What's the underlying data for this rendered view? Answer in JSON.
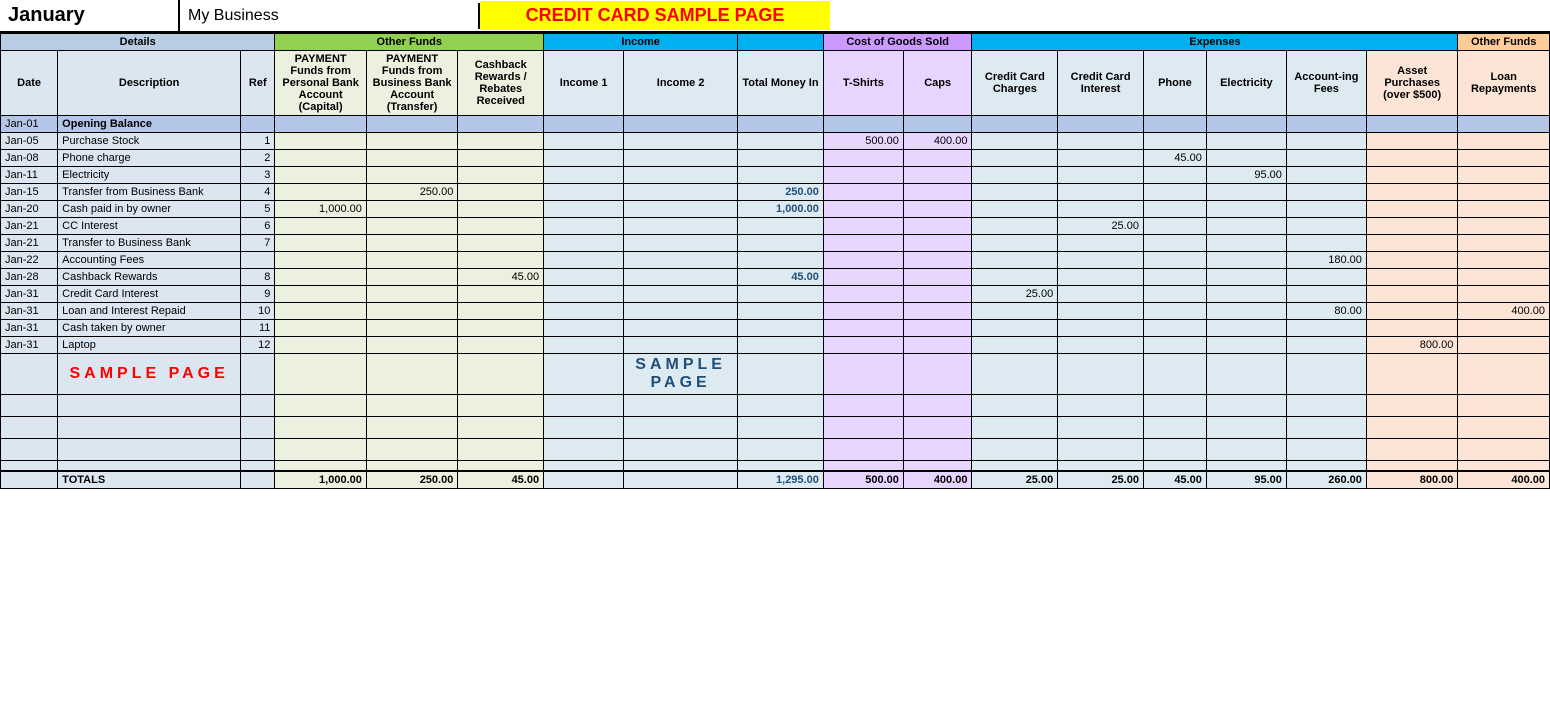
{
  "header": {
    "month": "January",
    "business": "My Business",
    "title": "CREDIT CARD SAMPLE PAGE"
  },
  "sections": {
    "details": "Details",
    "other_funds": "Other Funds",
    "income": "Income",
    "cogs": "Cost of Goods Sold",
    "expenses": "Expenses",
    "other_funds2": "Other Funds"
  },
  "columns": {
    "date": "Date",
    "description": "Description",
    "ref": "Ref",
    "payment_personal": "PAYMENT Funds from Personal Bank Account (Capital)",
    "payment_business": "PAYMENT Funds from Business Bank Account (Transfer)",
    "cashback": "Cashback Rewards / Rebates Received",
    "income1": "Income 1",
    "income2": "Income 2",
    "total_money_in": "Total Money In",
    "tshirts": "T-Shirts",
    "caps": "Caps",
    "cc_charges": "Credit Card Charges",
    "cc_interest": "Credit Card Interest",
    "phone": "Phone",
    "electricity": "Electricity",
    "accounting_fees": "Account-ing Fees",
    "asset_purchases": "Asset Purchases (over $500)",
    "loan_repayments": "Loan Repayments"
  },
  "rows": [
    {
      "date": "Jan-01",
      "desc": "Opening Balance",
      "ref": "",
      "pay_personal": "",
      "pay_business": "",
      "cashback": "",
      "inc1": "",
      "inc2": "",
      "total": "",
      "tshirts": "",
      "caps": "",
      "cc_charges": "",
      "cc_interest": "",
      "phone": "",
      "electricity": "",
      "acct_fees": "",
      "asset_purch": "",
      "loan_rep": "",
      "opening": true
    },
    {
      "date": "Jan-05",
      "desc": "Purchase Stock",
      "ref": "1",
      "pay_personal": "",
      "pay_business": "",
      "cashback": "",
      "inc1": "",
      "inc2": "",
      "total": "",
      "tshirts": "500.00",
      "caps": "400.00",
      "cc_charges": "",
      "cc_interest": "",
      "phone": "",
      "electricity": "",
      "acct_fees": "",
      "asset_purch": "",
      "loan_rep": ""
    },
    {
      "date": "Jan-08",
      "desc": "Phone charge",
      "ref": "2",
      "pay_personal": "",
      "pay_business": "",
      "cashback": "",
      "inc1": "",
      "inc2": "",
      "total": "",
      "tshirts": "",
      "caps": "",
      "cc_charges": "",
      "cc_interest": "",
      "phone": "45.00",
      "electricity": "",
      "acct_fees": "",
      "asset_purch": "",
      "loan_rep": ""
    },
    {
      "date": "Jan-11",
      "desc": "Electricity",
      "ref": "3",
      "pay_personal": "",
      "pay_business": "",
      "cashback": "",
      "inc1": "",
      "inc2": "",
      "total": "",
      "tshirts": "",
      "caps": "",
      "cc_charges": "",
      "cc_interest": "",
      "phone": "",
      "electricity": "95.00",
      "acct_fees": "",
      "asset_purch": "",
      "loan_rep": ""
    },
    {
      "date": "Jan-15",
      "desc": "Transfer from Business Bank",
      "ref": "4",
      "pay_personal": "",
      "pay_business": "250.00",
      "cashback": "",
      "inc1": "",
      "inc2": "",
      "total": "250.00",
      "tshirts": "",
      "caps": "",
      "cc_charges": "",
      "cc_interest": "",
      "phone": "",
      "electricity": "",
      "acct_fees": "",
      "asset_purch": "",
      "loan_rep": ""
    },
    {
      "date": "Jan-20",
      "desc": "Cash paid in by owner",
      "ref": "5",
      "pay_personal": "1,000.00",
      "pay_business": "",
      "cashback": "",
      "inc1": "",
      "inc2": "",
      "total": "1,000.00",
      "tshirts": "",
      "caps": "",
      "cc_charges": "",
      "cc_interest": "",
      "phone": "",
      "electricity": "",
      "acct_fees": "",
      "asset_purch": "",
      "loan_rep": ""
    },
    {
      "date": "Jan-21",
      "desc": "CC Interest",
      "ref": "6",
      "pay_personal": "",
      "pay_business": "",
      "cashback": "",
      "inc1": "",
      "inc2": "",
      "total": "",
      "tshirts": "",
      "caps": "",
      "cc_charges": "",
      "cc_interest": "25.00",
      "phone": "",
      "electricity": "",
      "acct_fees": "",
      "asset_purch": "",
      "loan_rep": ""
    },
    {
      "date": "Jan-21",
      "desc": "Transfer to Business Bank",
      "ref": "7",
      "pay_personal": "",
      "pay_business": "",
      "cashback": "",
      "inc1": "",
      "inc2": "",
      "total": "",
      "tshirts": "",
      "caps": "",
      "cc_charges": "",
      "cc_interest": "",
      "phone": "",
      "electricity": "",
      "acct_fees": "",
      "asset_purch": "",
      "loan_rep": ""
    },
    {
      "date": "Jan-22",
      "desc": "Accounting Fees",
      "ref": "",
      "pay_personal": "",
      "pay_business": "",
      "cashback": "",
      "inc1": "",
      "inc2": "",
      "total": "",
      "tshirts": "",
      "caps": "",
      "cc_charges": "",
      "cc_interest": "",
      "phone": "",
      "electricity": "",
      "acct_fees": "180.00",
      "asset_purch": "",
      "loan_rep": ""
    },
    {
      "date": "Jan-28",
      "desc": "Cashback Rewards",
      "ref": "8",
      "pay_personal": "",
      "pay_business": "",
      "cashback": "45.00",
      "inc1": "",
      "inc2": "",
      "total": "45.00",
      "tshirts": "",
      "caps": "",
      "cc_charges": "",
      "cc_interest": "",
      "phone": "",
      "electricity": "",
      "acct_fees": "",
      "asset_purch": "",
      "loan_rep": ""
    },
    {
      "date": "Jan-31",
      "desc": "Credit Card Interest",
      "ref": "9",
      "pay_personal": "",
      "pay_business": "",
      "cashback": "",
      "inc1": "",
      "inc2": "",
      "total": "",
      "tshirts": "",
      "caps": "",
      "cc_charges": "25.00",
      "cc_interest": "",
      "phone": "",
      "electricity": "",
      "acct_fees": "",
      "asset_purch": "",
      "loan_rep": ""
    },
    {
      "date": "Jan-31",
      "desc": "Loan and Interest Repaid",
      "ref": "10",
      "pay_personal": "",
      "pay_business": "",
      "cashback": "",
      "inc1": "",
      "inc2": "",
      "total": "",
      "tshirts": "",
      "caps": "",
      "cc_charges": "",
      "cc_interest": "",
      "phone": "",
      "electricity": "",
      "acct_fees": "80.00",
      "asset_purch": "",
      "loan_rep": "400.00"
    },
    {
      "date": "Jan-31",
      "desc": "Cash taken by owner",
      "ref": "11",
      "pay_personal": "",
      "pay_business": "",
      "cashback": "",
      "inc1": "",
      "inc2": "",
      "total": "",
      "tshirts": "",
      "caps": "",
      "cc_charges": "",
      "cc_interest": "",
      "phone": "",
      "electricity": "",
      "acct_fees": "",
      "asset_purch": "",
      "loan_rep": ""
    },
    {
      "date": "Jan-31",
      "desc": "Laptop",
      "ref": "12",
      "pay_personal": "",
      "pay_business": "",
      "cashback": "",
      "inc1": "",
      "inc2": "",
      "total": "",
      "tshirts": "",
      "caps": "",
      "cc_charges": "",
      "cc_interest": "",
      "phone": "",
      "electricity": "",
      "acct_fees": "",
      "asset_purch": "800.00",
      "loan_rep": ""
    }
  ],
  "blank_rows": 4,
  "totals": {
    "label": "TOTALS",
    "pay_personal": "1,000.00",
    "pay_business": "250.00",
    "cashback": "45.00",
    "inc1": "",
    "inc2": "",
    "total": "1,295.00",
    "tshirts": "500.00",
    "caps": "400.00",
    "cc_charges": "25.00",
    "cc_interest": "25.00",
    "phone": "45.00",
    "electricity": "95.00",
    "acct_fees": "260.00",
    "asset_purch": "800.00",
    "loan_rep": "400.00"
  },
  "sample_page_text": "SAMPLE PAGE"
}
